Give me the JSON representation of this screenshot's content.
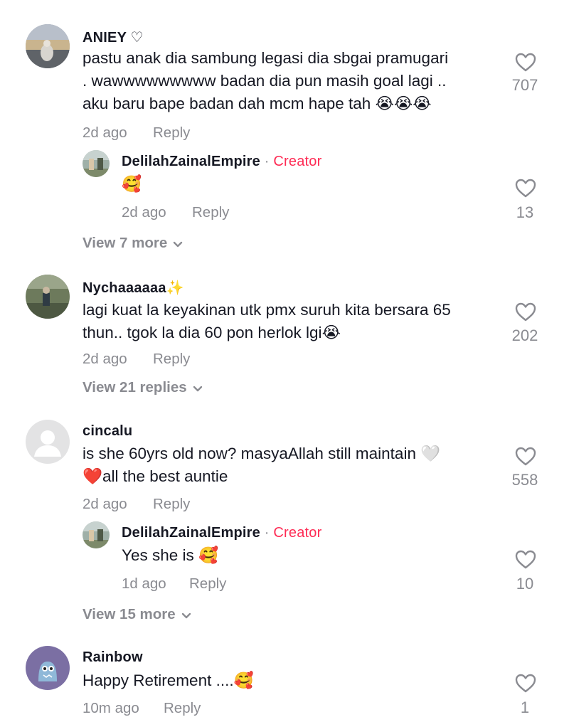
{
  "comments": [
    {
      "username": "ANIEY ♡",
      "text": "pastu anak dia sambung legasi dia sbgai pramugari\n. wawwwwwwwww badan dia pun masih goal lagi ..\naku baru bape badan dah mcm hape tah 😭😭😭",
      "time": "2d ago",
      "reply_label": "Reply",
      "likes": "707",
      "reply": {
        "username": "DelilahZainalEmpire",
        "separator": "·",
        "badge": "Creator",
        "text": "🥰",
        "time": "2d ago",
        "reply_label": "Reply",
        "likes": "13"
      },
      "view_more": "View 7 more"
    },
    {
      "username": "Nychaaaaaa✨",
      "text": "lagi kuat la keyakinan utk pmx suruh kita bersara 65\nthun.. tgok la dia 60 pon herlok lgi😭",
      "time": "2d ago",
      "reply_label": "Reply",
      "likes": "202",
      "view_more": "View 21 replies"
    },
    {
      "username": "cincalu",
      "text": "is she 60yrs old now? masyaAllah still maintain 🤍\n❤️all the best auntie",
      "time": "2d ago",
      "reply_label": "Reply",
      "likes": "558",
      "reply": {
        "username": "DelilahZainalEmpire",
        "separator": "·",
        "badge": "Creator",
        "text": "Yes she is 🥰",
        "time": "1d ago",
        "reply_label": "Reply",
        "likes": "10"
      },
      "view_more": "View 15 more"
    },
    {
      "username": "Rainbow",
      "text": "Happy Retirement ....🥰",
      "time": "10m ago",
      "reply_label": "Reply",
      "likes": "1"
    }
  ],
  "icons": {
    "like": "heart-outline-icon",
    "expand": "chevron-down-icon"
  },
  "colors": {
    "creator_badge": "#fe2c55",
    "secondary_text": "#8a8b91",
    "primary_text": "#161823"
  }
}
